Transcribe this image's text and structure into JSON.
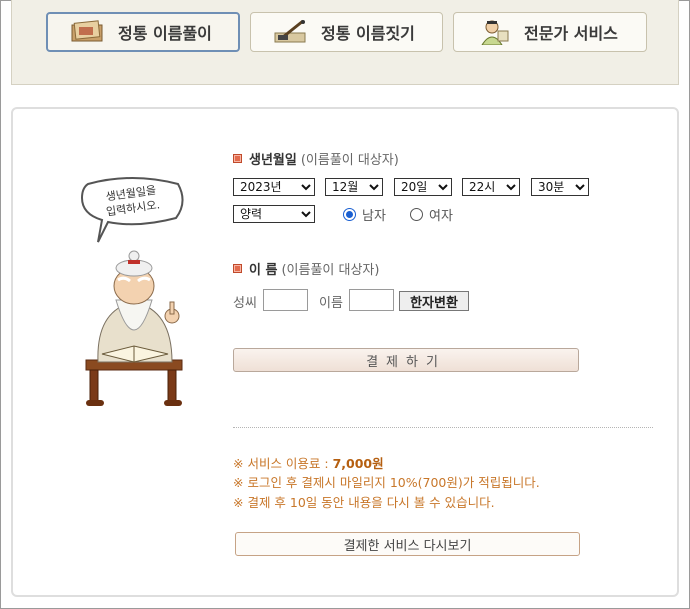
{
  "tabs": [
    {
      "label": "정통 이름풀이",
      "active": true
    },
    {
      "label": "정통 이름짓기",
      "active": false
    },
    {
      "label": "전문가 서비스",
      "active": false
    }
  ],
  "speech_bubble": {
    "line1": "생년월일을",
    "line2": "입력하시오."
  },
  "birth": {
    "title": "생년월일",
    "subtitle": "(이름풀이 대상자)",
    "year": "2023년",
    "month": "12월",
    "day": "20일",
    "hour": "22시",
    "minute": "30분",
    "calendar": "양력",
    "gender_male": "남자",
    "gender_female": "여자",
    "selected_gender": "male"
  },
  "name": {
    "title": "이 름",
    "subtitle": "(이름풀이 대상자)",
    "surname_label": "성씨",
    "surname_value": "",
    "given_label": "이름",
    "given_value": "",
    "hanja_button": "한자변환"
  },
  "pay_button": "결제하기",
  "notes": {
    "fee_prefix": "※ 서비스 이용료 : ",
    "fee_value": "7,000원",
    "mileage": "※ 로그인 후 결제시 마일리지 10%(700원)가 적립됩니다.",
    "review": "※ 결제 후 10일 동안 내용을 다시 볼 수 있습니다."
  },
  "review_button": "결제한 서비스 다시보기",
  "colors": {
    "bullet": "#e36b4d",
    "note_text": "#c8772a",
    "active_tab_border": "#6f8fb5",
    "radio_selected": "#1a5fd1"
  }
}
